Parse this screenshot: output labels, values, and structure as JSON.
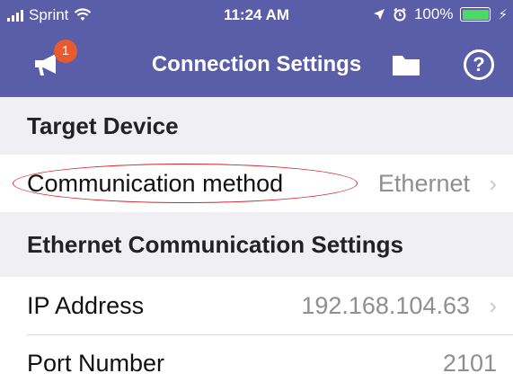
{
  "status_bar": {
    "carrier": "Sprint",
    "time": "11:24 AM",
    "battery": "100%",
    "battery_level": 1.0
  },
  "navbar": {
    "title": "Connection Settings",
    "notification_count": "1",
    "help_glyph": "?"
  },
  "sections": {
    "target_device": "Target Device",
    "ethernet": "Ethernet Communication Settings"
  },
  "rows": {
    "communication_method": {
      "label": "Communication method",
      "value": "Ethernet"
    },
    "ip_address": {
      "label": "IP Address",
      "value": "192.168.104.63"
    },
    "port_number": {
      "label": "Port Number",
      "value": "2101"
    }
  },
  "colors": {
    "header": "#5a5ea8",
    "section_bg": "#efeff4",
    "badge": "#ea5a2e",
    "annotation": "#d4232a"
  },
  "icons": [
    "signal-icon",
    "wifi-icon",
    "location-icon",
    "alarm-icon",
    "battery-icon",
    "charging-icon",
    "megaphone-icon",
    "folder-icon",
    "help-icon",
    "chevron-right-icon"
  ]
}
